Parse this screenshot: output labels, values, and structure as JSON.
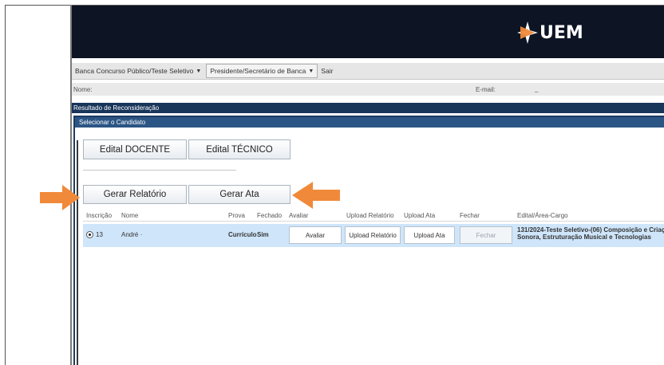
{
  "banner": {
    "logo_text": "UEM",
    "brand_color": "#0d1424"
  },
  "menubar": {
    "items": [
      {
        "label": "Banca Concurso Público/Teste Seletivo",
        "has_caret": true
      },
      {
        "label": "Presidente/Secretário de Banca",
        "has_caret": true
      },
      {
        "label": "Sair",
        "has_caret": false
      }
    ]
  },
  "user": {
    "name_label": "Nome:",
    "email_label": "E-mail:",
    "email_value": "_"
  },
  "section": {
    "title": "Resultado de Reconsideração"
  },
  "panel": {
    "title": "Selecionar o Candidato",
    "tabs": [
      {
        "label": "Edital DOCENTE"
      },
      {
        "label": "Edital TÉCNICO"
      }
    ],
    "actions": [
      {
        "label": "Gerar Relatório"
      },
      {
        "label": "Gerar Ata"
      }
    ]
  },
  "grid": {
    "columns": [
      "Inscrição",
      "Nome",
      "Prova",
      "Fechado",
      "Avaliar",
      "Upload Relatório",
      "Upload Ata",
      "Fechar",
      "Edital/Área-Cargo"
    ],
    "rows": [
      {
        "selected": true,
        "inscricao": "13",
        "nome": "André ·",
        "prova": "Currículo",
        "fechado": "Sim",
        "avaliar": "Avaliar",
        "upload_relatorio": "Upload Relatório",
        "upload_ata": "Upload Ata",
        "fechar": "Fechar",
        "edital_line1": "131/2024-Teste Seletivo-(06) Composição e Criaç",
        "edital_line2": "Sonora, Estruturação Musical e Tecnologias"
      }
    ]
  },
  "colors": {
    "arrow": "#f08a3a",
    "section_bar": "#18355a",
    "panel_title": "#2b5584",
    "row_highlight": "#cfe5fa"
  }
}
